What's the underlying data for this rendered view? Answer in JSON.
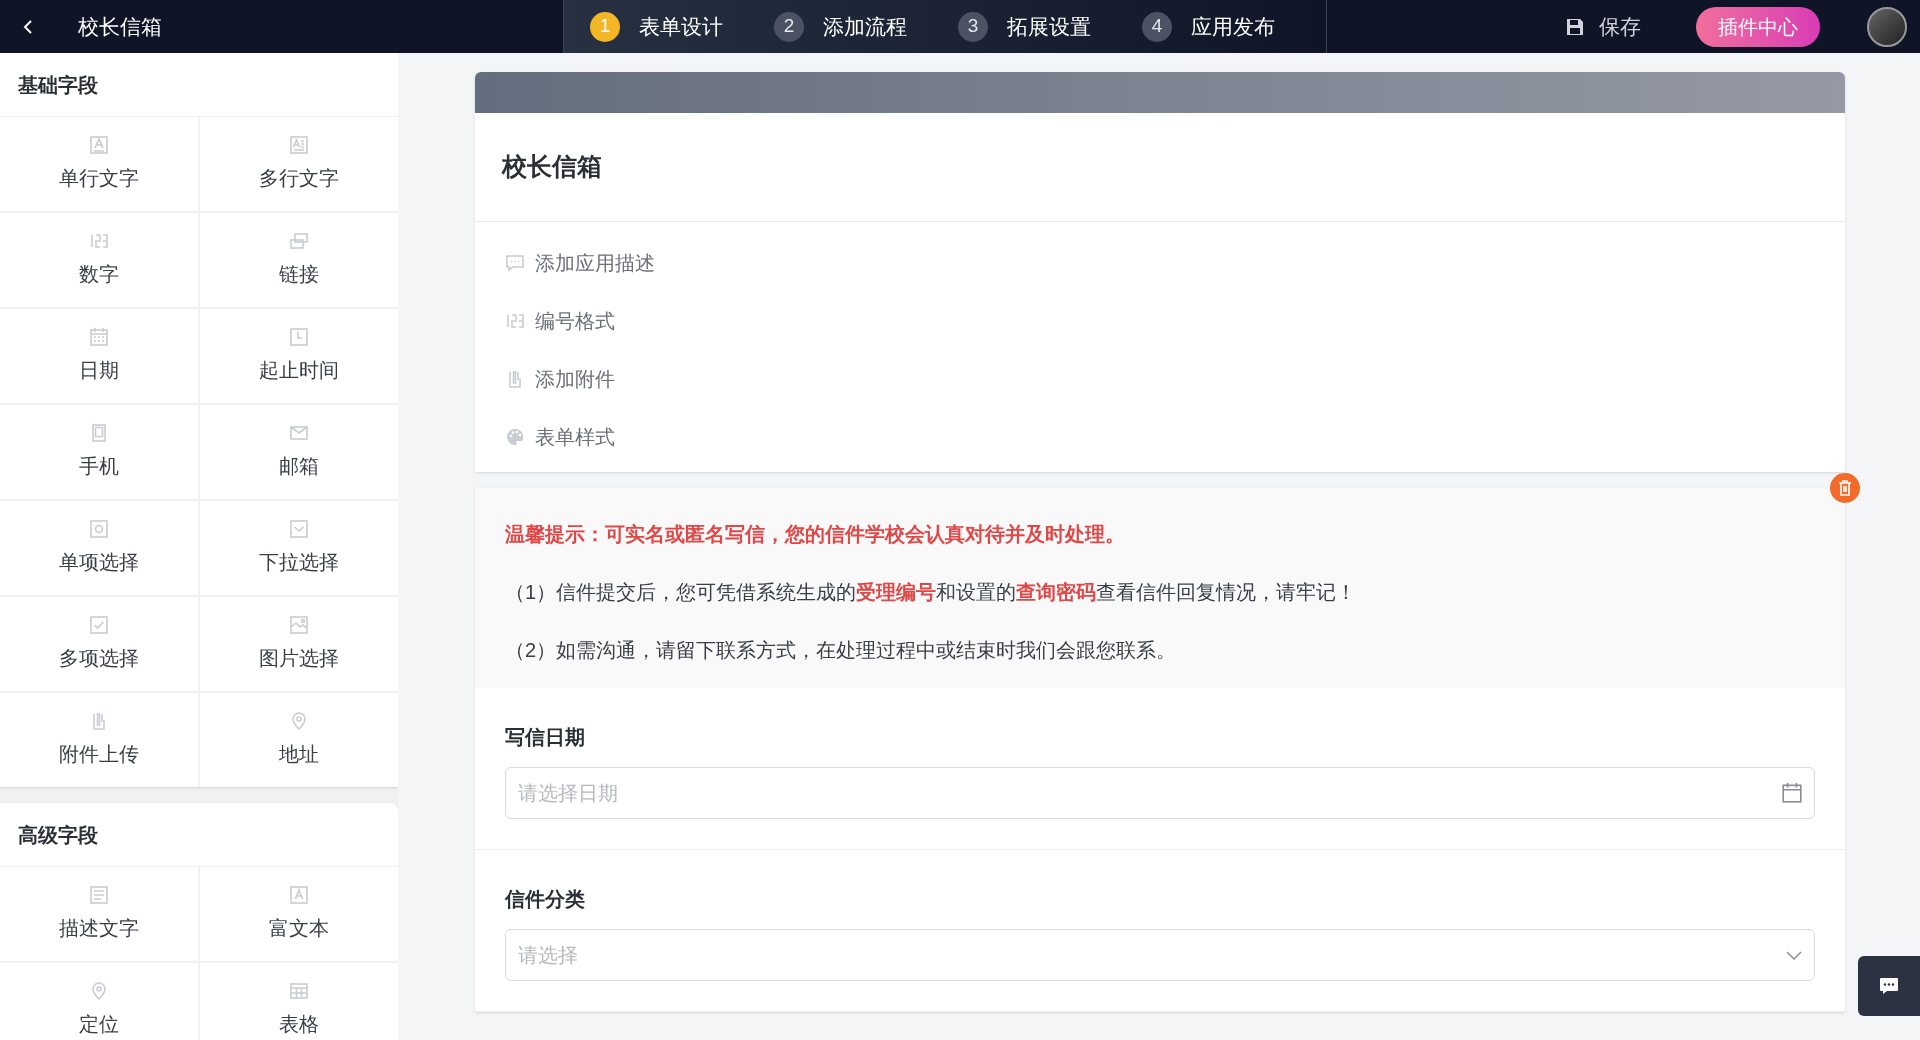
{
  "top_bar": {
    "title": "校长信箱",
    "steps": [
      {
        "number": "1",
        "label": "表单设计",
        "selected": true
      },
      {
        "number": "2",
        "label": "添加流程",
        "selected": false
      },
      {
        "number": "3",
        "label": "拓展设置",
        "selected": false
      },
      {
        "number": "4",
        "label": "应用发布",
        "selected": false
      }
    ],
    "save": "保存",
    "plugin_button": "插件中心"
  },
  "sidebar": {
    "groups": [
      {
        "title": "基础字段",
        "items": [
          {
            "label": "单行文字",
            "kind": "text"
          },
          {
            "label": "多行文字",
            "kind": "textarea"
          },
          {
            "label": "数字",
            "kind": "number"
          },
          {
            "label": "链接",
            "kind": "link"
          },
          {
            "label": "日期",
            "kind": "date"
          },
          {
            "label": "起止时间",
            "kind": "time"
          },
          {
            "label": "手机",
            "kind": "phone"
          },
          {
            "label": "邮箱",
            "kind": "mail"
          },
          {
            "label": "单项选择",
            "kind": "radio"
          },
          {
            "label": "下拉选择",
            "kind": "select"
          },
          {
            "label": "多项选择",
            "kind": "checkbox"
          },
          {
            "label": "图片选择",
            "kind": "image"
          },
          {
            "label": "附件上传",
            "kind": "attachment"
          },
          {
            "label": "地址",
            "kind": "location"
          }
        ]
      },
      {
        "title": "高级字段",
        "items": [
          {
            "label": "描述文字",
            "kind": "description"
          },
          {
            "label": "富文本",
            "kind": "richtext"
          },
          {
            "label": "定位",
            "kind": "location"
          },
          {
            "label": "表格",
            "kind": "table"
          }
        ]
      }
    ]
  },
  "form": {
    "title": "校长信箱",
    "options": [
      {
        "label": "添加应用描述",
        "kind": "comment"
      },
      {
        "label": "编号格式",
        "kind": "number"
      },
      {
        "label": "添加附件",
        "kind": "attachment"
      },
      {
        "label": "表单样式",
        "kind": "palette"
      }
    ],
    "notice": [
      {
        "text": "温馨提示：可实名或匿名写信，您的信件学校会认真对待并及时处理。",
        "kind": "headline"
      },
      {
        "text": "（1）信件提交后，您可凭借系统生成的**受理编号**和设置的**查询密码**查看信件回复情况，请牢记！",
        "kind": "body"
      },
      {
        "text": "（2）如需沟通，请留下联系方式，在处理过程中或结束时我们会跟您联系。",
        "kind": "body"
      }
    ],
    "fields": [
      {
        "label": "写信日期",
        "placeholder": "请选择日期",
        "kind": "date"
      },
      {
        "label": "信件分类",
        "placeholder": "请选择",
        "kind": "select"
      }
    ]
  }
}
